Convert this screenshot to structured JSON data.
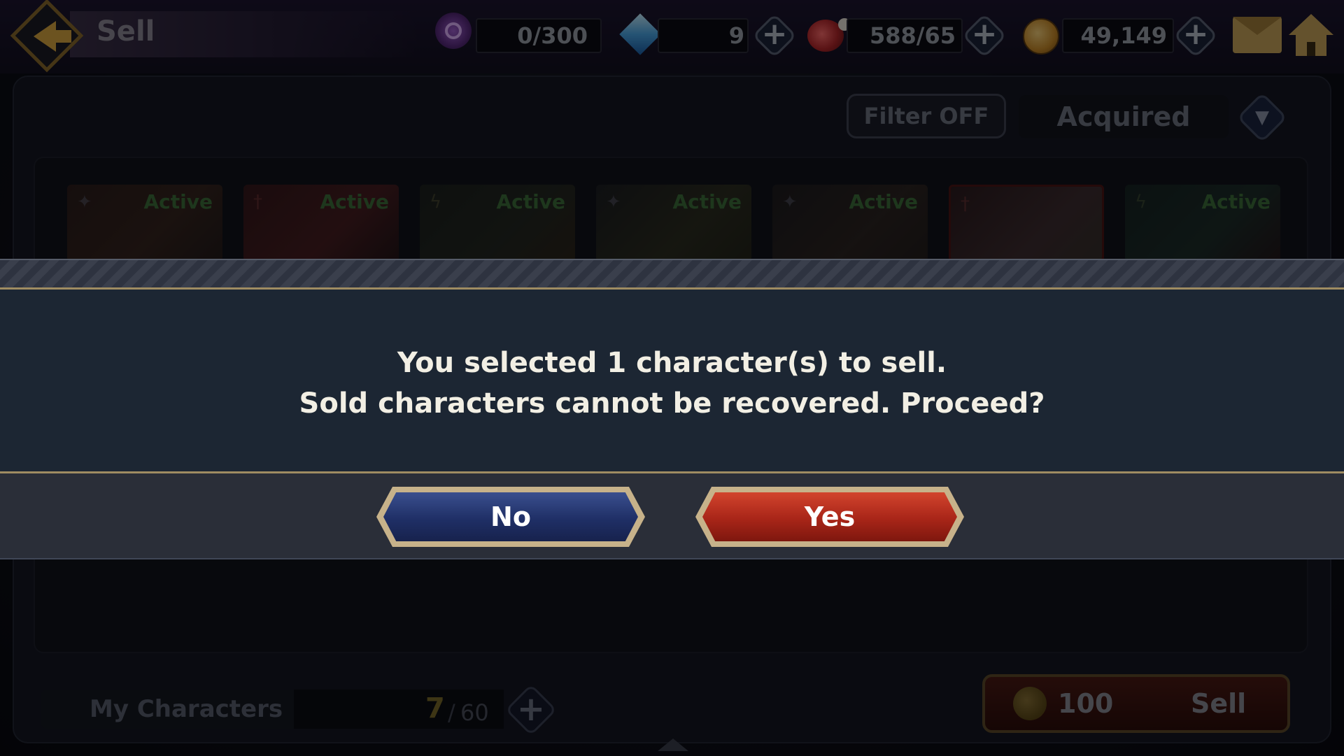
{
  "header": {
    "title": "Sell",
    "resources": [
      {
        "name": "portal",
        "value": "0/300",
        "icon": "portal-icon"
      },
      {
        "name": "gems",
        "value": "9",
        "icon": "gem-icon"
      },
      {
        "name": "stamina",
        "value": "588/65",
        "icon": "meat-icon"
      },
      {
        "name": "gold",
        "value": "49,149",
        "icon": "coin-icon"
      }
    ]
  },
  "toolbar": {
    "filter_label": "Filter OFF",
    "sort_label": "Acquired"
  },
  "characters": {
    "cards": [
      {
        "badge": "Active",
        "element": "star"
      },
      {
        "badge": "Active",
        "element": "sword"
      },
      {
        "badge": "Active",
        "element": "lightning"
      },
      {
        "badge": "Active",
        "element": "star"
      },
      {
        "badge": "Active",
        "element": "star"
      },
      {
        "badge": "",
        "element": "sword"
      },
      {
        "badge": "Active",
        "element": "lightning"
      }
    ]
  },
  "footer": {
    "label": "My Characters",
    "current": "7",
    "separator": "/",
    "max": "60",
    "sell_cost": "100",
    "sell_label": "Sell"
  },
  "dialog": {
    "line1": "You selected 1 character(s) to sell.",
    "line2": "Sold characters cannot be recovered. Proceed?",
    "no_label": "No",
    "yes_label": "Yes"
  },
  "colors": {
    "accent_gold": "#c9a45a",
    "no_button": "#1f2f66",
    "yes_button": "#a82518",
    "active_badge": "#3c6f3a"
  }
}
